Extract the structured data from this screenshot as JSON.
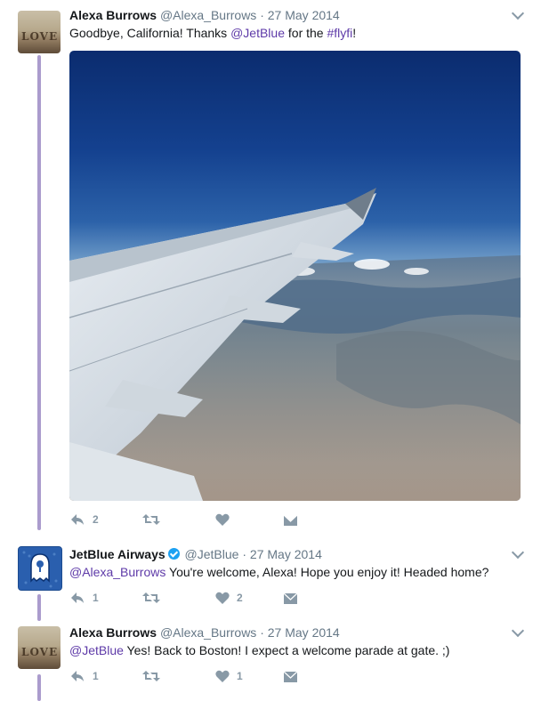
{
  "tweets": [
    {
      "name": "Alexa Burrows",
      "handle": "@Alexa_Burrows",
      "separator": "·",
      "date": "27 May 2014",
      "text_before": "Goodbye, California! Thanks ",
      "mention": "@JetBlue",
      "text_middle": " for the ",
      "hashtag": "#flyfi",
      "text_after": "!",
      "avatar_text": "LOVE",
      "actions": {
        "reply_count": "2",
        "retweet_count": "",
        "like_count": ""
      }
    },
    {
      "name": "JetBlue Airways",
      "handle": "@JetBlue",
      "separator": "·",
      "date": "27 May 2014",
      "mention": "@Alexa_Burrows",
      "text": " You're welcome, Alexa! Hope you enjoy it! Headed home?",
      "actions": {
        "reply_count": "1",
        "retweet_count": "",
        "like_count": "2"
      }
    },
    {
      "name": "Alexa Burrows",
      "handle": "@Alexa_Burrows",
      "separator": "·",
      "date": "27 May 2014",
      "mention": "@JetBlue",
      "text": " Yes! Back to Boston! I expect a welcome parade at gate. ;)",
      "avatar_text": "LOVE",
      "actions": {
        "reply_count": "1",
        "retweet_count": "",
        "like_count": "1"
      }
    }
  ],
  "icons": {
    "reply": "reply-icon",
    "retweet": "retweet-icon",
    "like": "heart-icon",
    "dm": "envelope-icon",
    "more": "chevron-down-icon",
    "verified": "verified-badge-icon"
  },
  "colors": {
    "link": "#5e3aa8",
    "thread_line": "#ab9ccd",
    "meta": "#657786",
    "action": "#8899a6",
    "verified": "#1da1f2"
  }
}
